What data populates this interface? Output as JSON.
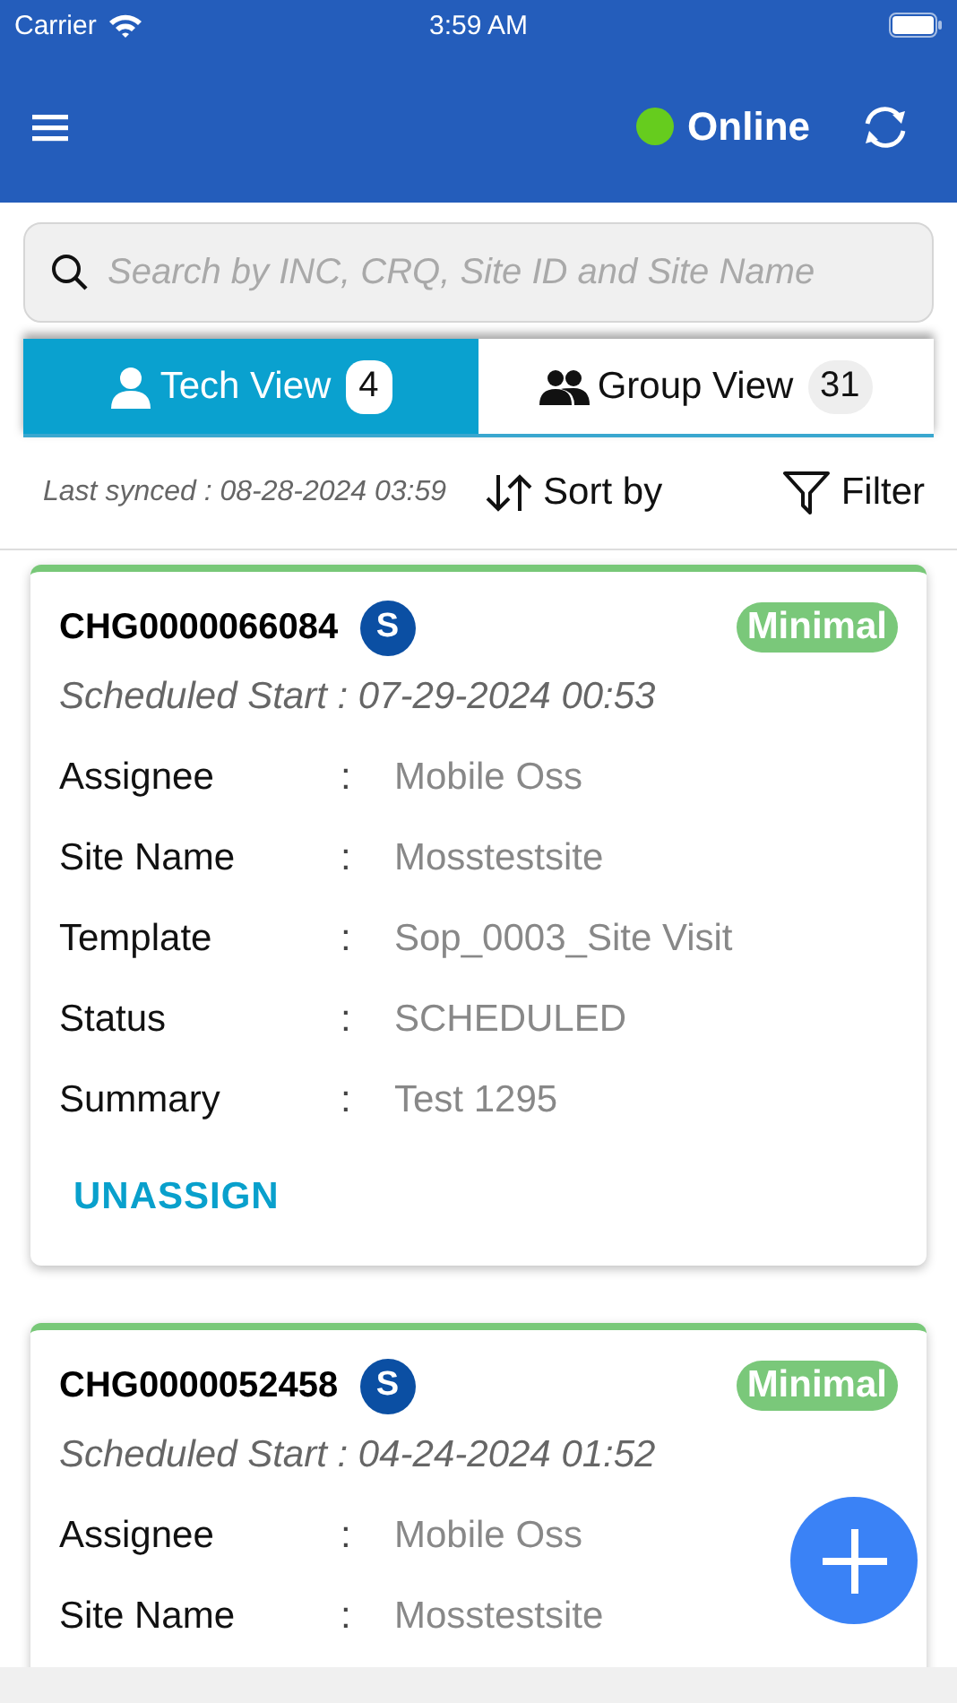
{
  "status_bar": {
    "carrier": "Carrier",
    "time": "3:59 AM"
  },
  "header": {
    "online": true,
    "status_label": "Online"
  },
  "search": {
    "placeholder": "Search by INC, CRQ, Site ID and Site Name"
  },
  "tabs": [
    {
      "kind": "single",
      "label": "Tech View",
      "count": "4",
      "selected": true
    },
    {
      "kind": "group",
      "label": "Group View",
      "count": "31",
      "selected": false
    }
  ],
  "toolbar": {
    "last_synced": "Last synced : 08-28-2024 03:59",
    "sort_label": "Sort by",
    "filter_label": "Filter"
  },
  "cards": [
    {
      "id": "CHG0000066084",
      "type_badge": "S",
      "priority": "Minimal",
      "scheduled": "Scheduled Start : 07-29-2024 00:53",
      "fields": [
        {
          "label": "Assignee",
          "separator": ":",
          "value": "Mobile Oss"
        },
        {
          "label": "Site Name",
          "separator": ":",
          "value": "Mosstestsite"
        },
        {
          "label": "Template",
          "separator": ":",
          "value": "Sop_0003_Site Visit"
        },
        {
          "label": "Status",
          "separator": ":",
          "value": "SCHEDULED"
        },
        {
          "label": "Summary",
          "separator": ":",
          "value": "Test 1295"
        }
      ],
      "action": "UNASSIGN"
    },
    {
      "id": "CHG0000052458",
      "type_badge": "S",
      "priority": "Minimal",
      "scheduled": "Scheduled Start : 04-24-2024 01:52",
      "fields": [
        {
          "label": "Assignee",
          "separator": ":",
          "value": "Mobile Oss"
        },
        {
          "label": "Site Name",
          "separator": ":",
          "value": "Mosstestsite"
        }
      ]
    }
  ]
}
